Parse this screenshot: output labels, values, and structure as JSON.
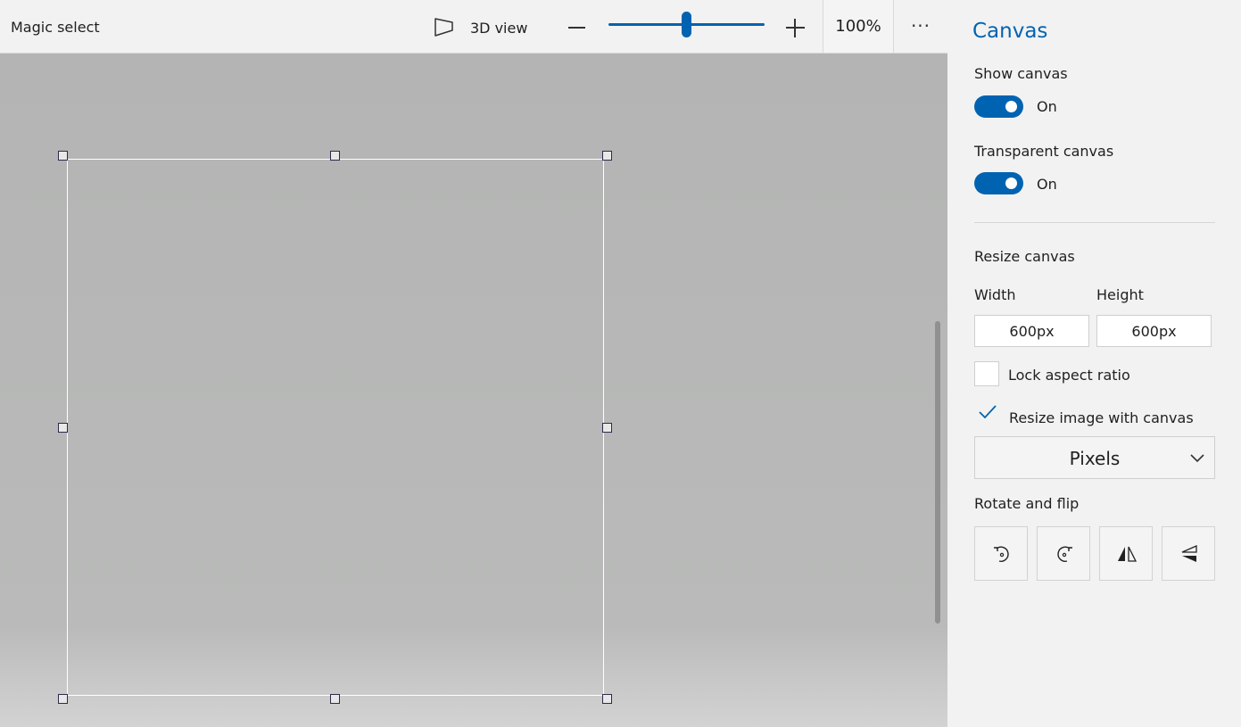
{
  "toolbar": {
    "magic_select_label": "Magic select",
    "view3d_label": "3D view",
    "zoom_value": "100%",
    "zoom_slider_fraction": 0.5,
    "more_label": "···"
  },
  "panel": {
    "title": "Canvas",
    "show_canvas": {
      "label": "Show canvas",
      "state_label": "On",
      "on": true
    },
    "transparent_canvas": {
      "label": "Transparent canvas",
      "state_label": "On",
      "on": true
    },
    "resize_canvas": {
      "label": "Resize canvas",
      "width_label": "Width",
      "height_label": "Height",
      "width_value": "600px",
      "height_value": "600px",
      "lock_aspect_label": "Lock aspect ratio",
      "lock_aspect_checked": false,
      "resize_image_label": "Resize image with canvas",
      "resize_image_checked": true,
      "units_selected": "Pixels"
    },
    "rotate_flip": {
      "label": "Rotate and flip",
      "buttons": [
        "rotate-left-icon",
        "rotate-right-icon",
        "flip-horizontal-icon",
        "flip-vertical-icon"
      ]
    }
  },
  "colors": {
    "accent": "#0063b1",
    "workspace": "#b5b6b5",
    "panel_bg": "#f2f2f2"
  }
}
